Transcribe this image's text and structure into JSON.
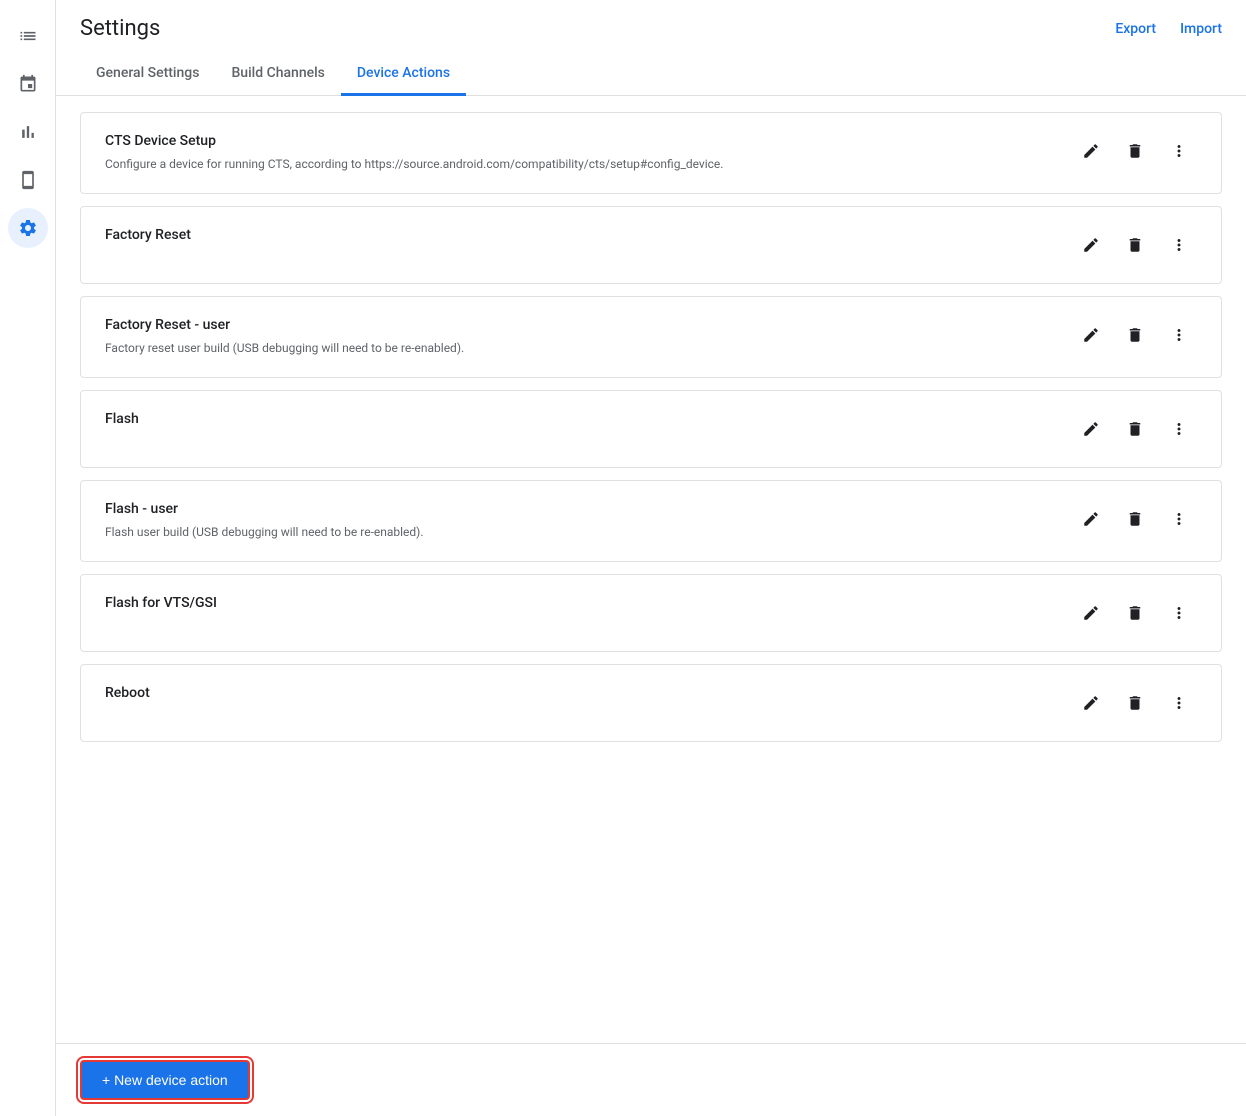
{
  "header": {
    "title": "Settings",
    "export_label": "Export",
    "import_label": "Import"
  },
  "tabs": [
    {
      "id": "general",
      "label": "General Settings",
      "active": false
    },
    {
      "id": "build-channels",
      "label": "Build Channels",
      "active": false
    },
    {
      "id": "device-actions",
      "label": "Device Actions",
      "active": true
    }
  ],
  "sidebar": {
    "items": [
      {
        "id": "list",
        "icon": "list",
        "active": false
      },
      {
        "id": "calendar",
        "icon": "calendar",
        "active": false
      },
      {
        "id": "chart",
        "icon": "chart",
        "active": false
      },
      {
        "id": "device",
        "icon": "device",
        "active": false
      },
      {
        "id": "settings",
        "icon": "settings",
        "active": true
      }
    ]
  },
  "device_actions": [
    {
      "id": "cts-device-setup",
      "title": "CTS Device Setup",
      "description": "Configure a device for running CTS, according to https://source.android.com/compatibility/cts/setup#config_device."
    },
    {
      "id": "factory-reset",
      "title": "Factory Reset",
      "description": ""
    },
    {
      "id": "factory-reset-user",
      "title": "Factory Reset - user",
      "description": "Factory reset user build (USB debugging will need to be re-enabled)."
    },
    {
      "id": "flash",
      "title": "Flash",
      "description": ""
    },
    {
      "id": "flash-user",
      "title": "Flash - user",
      "description": "Flash user build (USB debugging will need to be re-enabled)."
    },
    {
      "id": "flash-vts-gsi",
      "title": "Flash for VTS/GSI",
      "description": ""
    },
    {
      "id": "reboot",
      "title": "Reboot",
      "description": ""
    }
  ],
  "footer": {
    "new_action_label": "+ New device action"
  }
}
